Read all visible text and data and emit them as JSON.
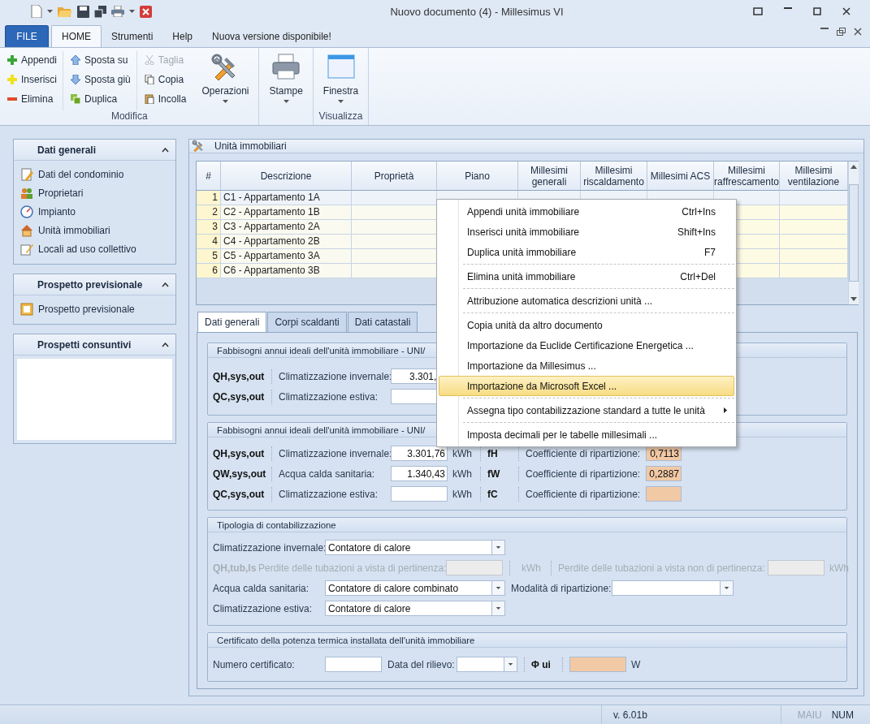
{
  "window": {
    "title": "Nuovo documento (4) - Millesimus VI"
  },
  "menu_tabs": [
    {
      "label": "FILE",
      "kind": "file",
      "selected": false
    },
    {
      "label": "HOME",
      "kind": "tab",
      "selected": true
    },
    {
      "label": "Strumenti",
      "kind": "tab",
      "selected": false
    },
    {
      "label": "Help",
      "kind": "tab",
      "selected": false
    },
    {
      "label": "Nuova versione disponibile!",
      "kind": "tab",
      "selected": false
    }
  ],
  "ribbon": {
    "groups": [
      {
        "label": "Modifica",
        "columns": [
          [
            {
              "label": "Appendi",
              "disabled": false
            },
            {
              "label": "Inserisci",
              "disabled": false
            },
            {
              "label": "Elimina",
              "disabled": false
            }
          ],
          [
            {
              "label": "Sposta su",
              "disabled": false
            },
            {
              "label": "Sposta giù",
              "disabled": false
            },
            {
              "label": "Duplica",
              "disabled": false
            }
          ],
          [
            {
              "label": "Taglia",
              "disabled": true
            },
            {
              "label": "Copia",
              "disabled": false
            },
            {
              "label": "Incolla",
              "disabled": false
            }
          ]
        ],
        "large": [
          {
            "label": "Operazioni"
          }
        ]
      },
      {
        "large": [
          {
            "label": "Stampe"
          }
        ]
      },
      {
        "label": "Visualizza",
        "large": [
          {
            "label": "Finestra"
          }
        ]
      }
    ]
  },
  "sidebar": {
    "panels": [
      {
        "title": "Dati generali",
        "expanded": true,
        "items": [
          {
            "label": "Dati del condominio"
          },
          {
            "label": "Proprietari"
          },
          {
            "label": "Impianto"
          },
          {
            "label": "Unità immobiliari"
          },
          {
            "label": "Locali ad uso collettivo"
          }
        ]
      },
      {
        "title": "Prospetto previsionale",
        "expanded": true,
        "items": [
          {
            "label": "Prospetto previsionale"
          }
        ]
      },
      {
        "title": "Prospetti consuntivi",
        "expanded": true
      }
    ]
  },
  "units_panel": {
    "title": "Unità immobiliari",
    "table": {
      "columns": [
        "#",
        "Descrizione",
        "Proprietà",
        "Piano",
        "Millesimi generali",
        "Millesimi riscaldamento",
        "Millesimi ACS",
        "Millesimi raffrescamento",
        "Millesimi ventilazione"
      ],
      "rows": [
        {
          "number": "1",
          "description": "C1 - Appartamento 1A",
          "selected": true
        },
        {
          "number": "2",
          "description": "C2 - Appartamento 1B",
          "selected": false
        },
        {
          "number": "3",
          "description": "C3 - Appartamento 2A",
          "selected": false
        },
        {
          "number": "4",
          "description": "C4 - Appartamento 2B",
          "selected": false
        },
        {
          "number": "5",
          "description": "C5 - Appartamento 3A",
          "selected": false
        },
        {
          "number": "6",
          "description": "C6 - Appartamento 3B",
          "selected": false
        }
      ]
    }
  },
  "detail_tabs": [
    {
      "label": "Dati generali",
      "selected": true
    },
    {
      "label": "Corpi scaldanti",
      "selected": false
    },
    {
      "label": "Dati catastali",
      "selected": false
    }
  ],
  "needs_group_1": {
    "title": "Fabbisogni annui ideali dell'unità immobiliare - UNI/",
    "rows": [
      {
        "symbol": "QH,sys,out",
        "label": "Climatizzazione invernale:",
        "value": "3.301,"
      },
      {
        "symbol": "QC,sys,out",
        "label": "Climatizzazione estiva:"
      }
    ]
  },
  "needs_group_2": {
    "title": "Fabbisogni annui ideali dell'unità immobiliare - UNI/",
    "rows": [
      {
        "symbol": "QH,sys,out",
        "label": "Climatizzazione invernale:",
        "value": "3.301,76",
        "unit": "kWh",
        "coef_symbol": "fH",
        "coef_label": "Coefficiente di ripartizione:",
        "coef_value": "0,7113"
      },
      {
        "symbol": "QW,sys,out",
        "label": "Acqua calda sanitaria:",
        "value": "1.340,43",
        "unit": "kWh",
        "coef_symbol": "fW",
        "coef_label": "Coefficiente di ripartizione:",
        "coef_value": "0,2887"
      },
      {
        "symbol": "QC,sys,out",
        "label": "Climatizzazione estiva:",
        "unit": "kWh",
        "coef_symbol": "fC",
        "coef_label": "Coefficiente di ripartizione:"
      }
    ]
  },
  "metering": {
    "title": "Tipologia di contabilizzazione",
    "rows": [
      {
        "kind": "select",
        "label": "Climatizzazione invernale:",
        "value": "Contatore di calore"
      },
      {
        "kind": "losses",
        "disabled": true,
        "symbol": "QH,tub,ls",
        "label": "Perdite delle tubazioni a vista di pertinenza:",
        "unit": "kWh",
        "label_2": "Perdite delle tubazioni a vista non di pertinenza:",
        "unit_2": "kWh"
      },
      {
        "kind": "select",
        "label": "Acqua calda sanitaria:",
        "value": "Contatore di calore combinato",
        "extra_label": "Modalità di ripartizione:"
      },
      {
        "kind": "select",
        "label": "Climatizzazione estiva:",
        "value": "Contatore di calore"
      }
    ]
  },
  "certificate": {
    "title": "Certificato della potenza termica installata dell'unità immobiliare",
    "number_label": "Numero certificato:",
    "date_label": "Data del rilievo:",
    "power_symbol": "Φ ui",
    "power_unit": "W"
  },
  "context_menu": {
    "sections": [
      [
        {
          "label": "Appendi unità immobiliare",
          "shortcut": "Ctrl+Ins",
          "selected": false,
          "submenu": false
        },
        {
          "label": "Inserisci unità immobiliare",
          "shortcut": "Shift+Ins",
          "selected": false,
          "submenu": false
        },
        {
          "label": "Duplica unità immobiliare",
          "shortcut": "F7",
          "selected": false,
          "submenu": false
        }
      ],
      [
        {
          "label": "Elimina unità immobiliare",
          "shortcut": "Ctrl+Del",
          "selected": false,
          "submenu": false
        }
      ],
      [
        {
          "label": "Attribuzione automatica descrizioni unità ...",
          "selected": false,
          "submenu": false
        }
      ],
      [
        {
          "label": "Copia unità da altro documento",
          "selected": false,
          "submenu": false
        },
        {
          "label": "Importazione da Euclide Certificazione Energetica ...",
          "selected": false,
          "submenu": false
        },
        {
          "label": "Importazione da Millesimus ...",
          "selected": false,
          "submenu": false
        },
        {
          "label": "Importazione da Microsoft Excel ...",
          "selected": true,
          "submenu": false
        }
      ],
      [
        {
          "label": "Assegna tipo contabilizzazione standard a tutte le unità",
          "selected": false,
          "submenu": true
        }
      ],
      [
        {
          "label": "Imposta decimali per le tabelle millesimali ...",
          "selected": false,
          "submenu": false
        }
      ]
    ]
  },
  "status_bar": {
    "version": "v. 6.01b",
    "keys": [
      {
        "label": "MAIU",
        "on": false
      },
      {
        "label": "NUM",
        "on": true
      }
    ]
  }
}
